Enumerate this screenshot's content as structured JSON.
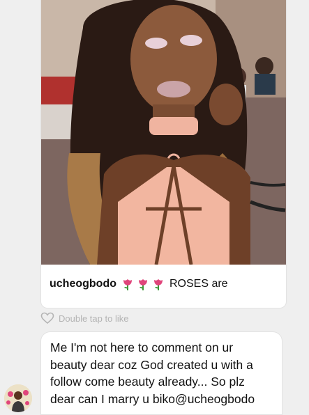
{
  "post": {
    "username": "ucheogbodo",
    "caption_text": "ROSES are",
    "emojis": [
      "rose-icon",
      "rose-icon",
      "rose-icon"
    ]
  },
  "like_hint": "Double tap to like",
  "comment": {
    "lines": [
      "Me I'm not here to comment on ur",
      "beauty dear coz God created u with a",
      "follow come beauty already... So plz",
      "dear can I marry u biko@ucheogbodo"
    ]
  },
  "colors": {
    "rose": "#e0457b",
    "leaf": "#3f9a3a",
    "hint": "#b4b4b4",
    "card_border": "#e2e2e2"
  }
}
